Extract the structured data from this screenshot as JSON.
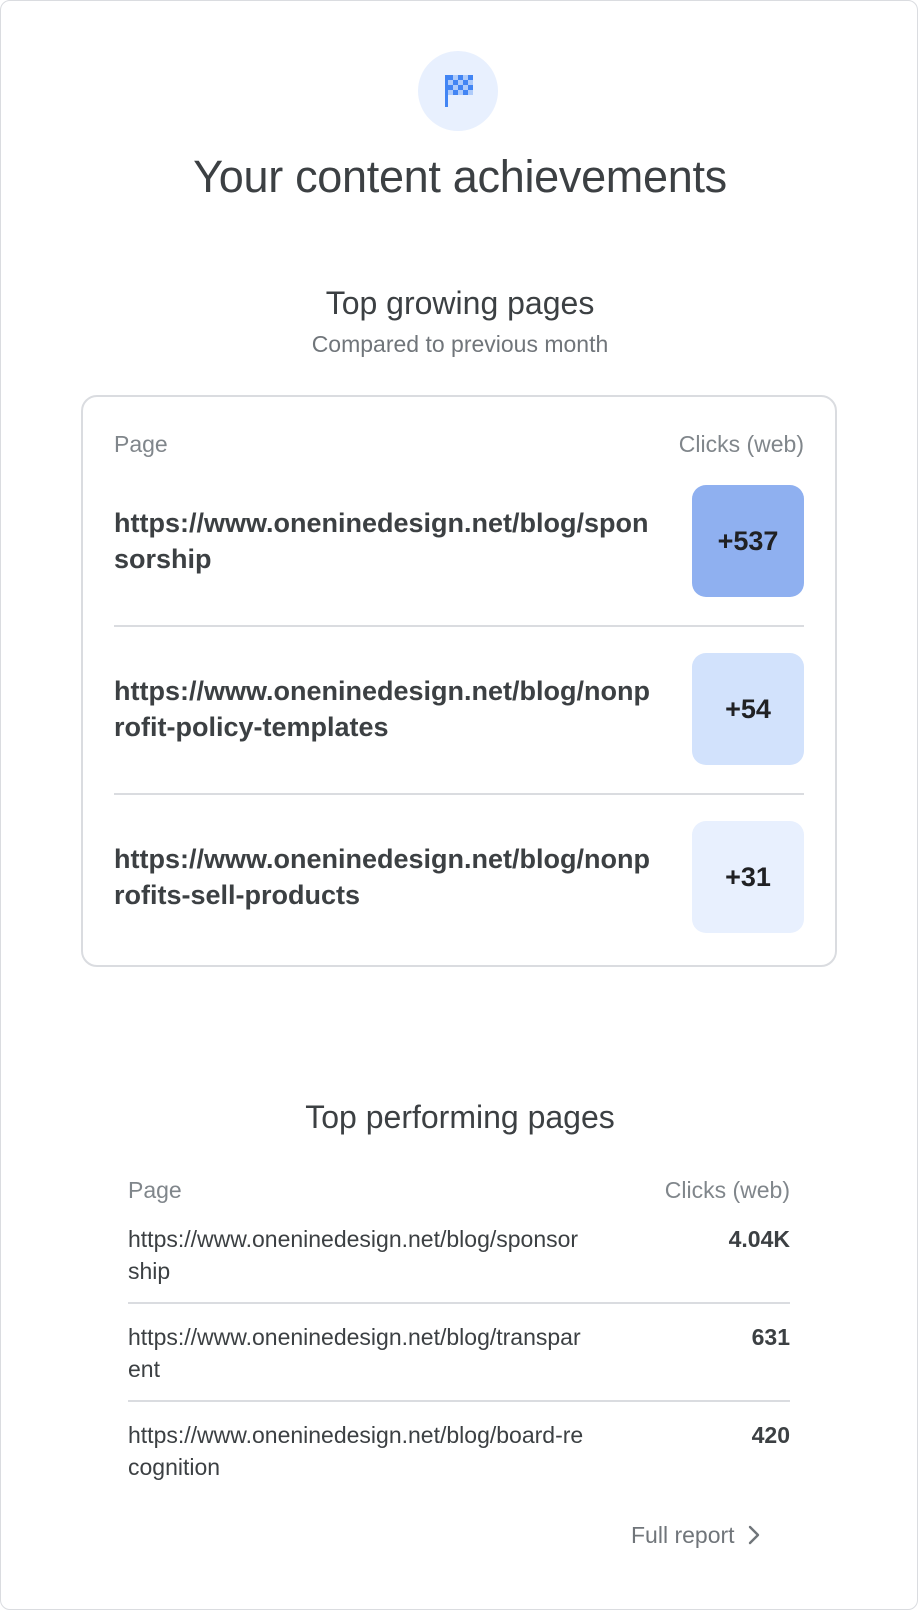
{
  "header": {
    "icon": "checkered-flag-icon",
    "title": "Your content achievements"
  },
  "colors": {
    "accent": "#4285f4",
    "badge_strong": "#8fb0f0",
    "badge_medium": "#d2e2fc",
    "badge_light": "#e8f0fe"
  },
  "top_growing": {
    "title": "Top growing pages",
    "subtitle": "Compared to previous month",
    "col_page": "Page",
    "col_clicks": "Clicks (web)",
    "rows": [
      {
        "url": "https://www.oneninedesign.net/blog/sponsorship",
        "value": "+537"
      },
      {
        "url": "https://www.oneninedesign.net/blog/nonprofit-policy-templates",
        "value": "+54"
      },
      {
        "url": "https://www.oneninedesign.net/blog/nonprofits-sell-products",
        "value": "+31"
      }
    ]
  },
  "top_performing": {
    "title": "Top performing pages",
    "col_page": "Page",
    "col_clicks": "Clicks (web)",
    "rows": [
      {
        "url": "https://www.oneninedesign.net/blog/sponsorship",
        "value": "4.04K"
      },
      {
        "url": "https://www.oneninedesign.net/blog/transparent",
        "value": "631"
      },
      {
        "url": "https://www.oneninedesign.net/blog/board-recognition",
        "value": "420"
      }
    ],
    "full_report": "Full report"
  }
}
